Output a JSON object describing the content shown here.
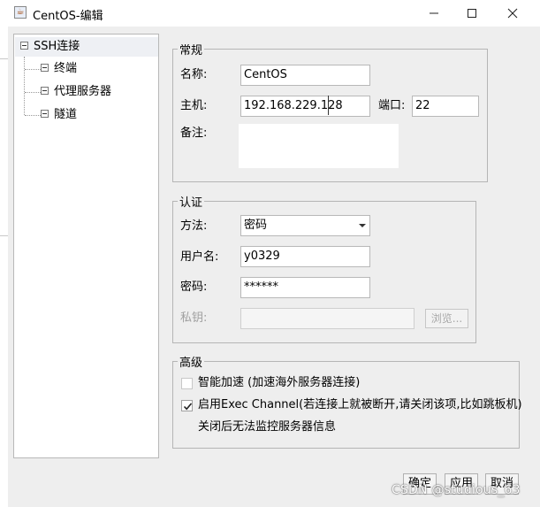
{
  "window": {
    "title": "CentOS-编辑",
    "minimize_glyph": "—",
    "maximize_glyph": "☐",
    "close_glyph": "✕"
  },
  "tree": {
    "root": "SSH连接",
    "children": [
      "终端",
      "代理服务器",
      "隧道"
    ]
  },
  "general": {
    "legend": "常规",
    "name_label": "名称:",
    "name_value": "CentOS",
    "host_label": "主机:",
    "host_value": "192.168.229.128",
    "port_label": "端口:",
    "port_value": "22",
    "note_label": "备注:",
    "note_value": ""
  },
  "auth": {
    "legend": "认证",
    "method_label": "方法:",
    "method_value": "密码",
    "user_label": "用户名:",
    "user_value": "y0329",
    "password_label": "密码:",
    "password_value": "******",
    "key_label": "私钥:",
    "key_value": "",
    "browse_label": "浏览..."
  },
  "advanced": {
    "legend": "高级",
    "accel_label": "智能加速 (加速海外服务器连接)",
    "accel_checked": false,
    "exec_label": "启用Exec Channel(若连接上就被断开,请关闭该项,比如跳板机)",
    "exec_checked": true,
    "exec_note": "关闭后无法监控服务器信息"
  },
  "buttons": {
    "ok": "确定",
    "apply": "应用",
    "cancel": "取消"
  },
  "watermark": "CSDN @studious_63"
}
